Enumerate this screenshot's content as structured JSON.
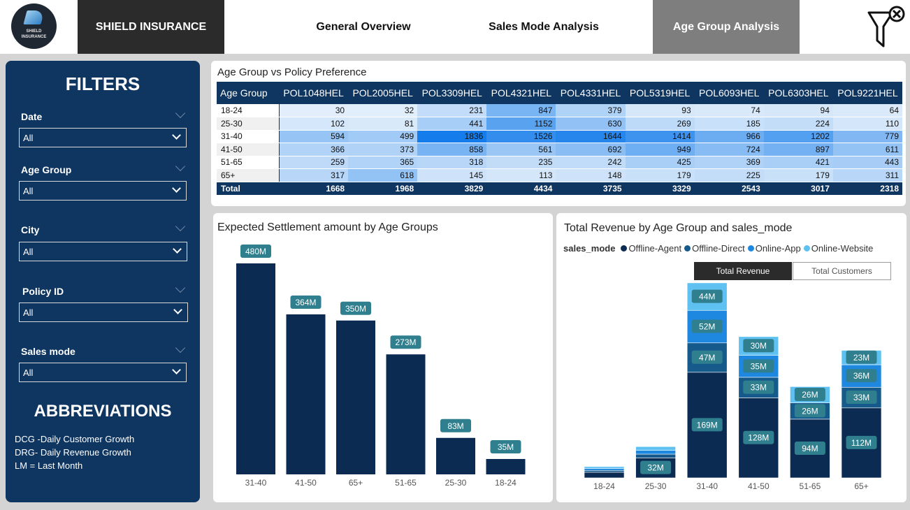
{
  "header": {
    "logo_text_line1": "SHIELD",
    "logo_text_line2": "INSURANCE",
    "brand": "SHIELD INSURANCE",
    "tabs": [
      {
        "label": "General Overview"
      },
      {
        "label": "Sales Mode Analysis"
      },
      {
        "label": "Age Group Analysis"
      }
    ],
    "clear_filter_icon": "filter-clear-icon"
  },
  "sidebar": {
    "title": "FILTERS",
    "filters": [
      {
        "label": "Date",
        "value": "All"
      },
      {
        "label": "Age Group",
        "value": "All"
      },
      {
        "label": "City",
        "value": "All"
      },
      {
        "label": "Policy ID",
        "value": "All"
      },
      {
        "label": "Sales mode",
        "value": "All"
      }
    ],
    "abbr_title": "ABBREVIATIONS",
    "abbreviations": [
      "DCG -Daily Customer Growth",
      "DRG- Daily Revenue Growth",
      "LM = Last Month"
    ]
  },
  "matrix": {
    "title": "Age Group vs Policy Preference",
    "row_header": "Age Group",
    "columns": [
      "POL1048HEL",
      "POL2005HEL",
      "POL3309HEL",
      "POL4321HEL",
      "POL4331HEL",
      "POL5319HEL",
      "POL6093HEL",
      "POL6303HEL",
      "POL9221HEL"
    ],
    "rows": [
      {
        "label": "18-24",
        "values": [
          30,
          32,
          231,
          847,
          379,
          93,
          74,
          94,
          64
        ]
      },
      {
        "label": "25-30",
        "values": [
          102,
          81,
          441,
          1152,
          630,
          269,
          185,
          224,
          110
        ]
      },
      {
        "label": "31-40",
        "values": [
          594,
          499,
          1836,
          1526,
          1644,
          1414,
          966,
          1202,
          779
        ]
      },
      {
        "label": "41-50",
        "values": [
          366,
          373,
          858,
          561,
          692,
          949,
          724,
          897,
          611
        ]
      },
      {
        "label": "51-65",
        "values": [
          259,
          365,
          318,
          235,
          242,
          425,
          369,
          421,
          443
        ]
      },
      {
        "label": "65+",
        "values": [
          317,
          618,
          145,
          113,
          148,
          179,
          225,
          179,
          311
        ]
      }
    ],
    "total": {
      "label": "Total",
      "values": [
        1668,
        1968,
        3829,
        4434,
        3735,
        3329,
        2543,
        3017,
        2318
      ]
    }
  },
  "settlement": {
    "title": "Expected Settlement amount by Age Groups"
  },
  "revenue": {
    "title": "Total Revenue by Age Group and sales_mode",
    "legend_title": "sales_mode",
    "toggle_active": "Total Revenue",
    "toggle_inactive": "Total Customers"
  },
  "chart_data": [
    {
      "type": "bar",
      "title": "Expected Settlement amount by Age Groups",
      "categories": [
        "31-40",
        "41-50",
        "65+",
        "51-65",
        "25-30",
        "18-24"
      ],
      "values": [
        480,
        364,
        350,
        273,
        83,
        35
      ],
      "labels": [
        "480M",
        "364M",
        "350M",
        "273M",
        "83M",
        "35M"
      ],
      "unit": "M",
      "color": "#0b2b53",
      "label_color": "#2f7f8f"
    },
    {
      "type": "bar",
      "stacked": true,
      "title": "Total Revenue by Age Group and sales_mode",
      "categories": [
        "18-24",
        "25-30",
        "31-40",
        "41-50",
        "51-65",
        "65+"
      ],
      "series": [
        {
          "name": "Offline-Agent",
          "color": "#0b2b53",
          "values": [
            9,
            32,
            169,
            128,
            94,
            112
          ]
        },
        {
          "name": "Offline-Direct",
          "color": "#165a8c",
          "values": [
            3,
            6,
            47,
            33,
            26,
            33
          ]
        },
        {
          "name": "Online-App",
          "color": "#1e88e0",
          "values": [
            3,
            6,
            52,
            35,
            0,
            36
          ]
        },
        {
          "name": "Online-Website",
          "color": "#5ec1f2",
          "values": [
            3,
            6,
            44,
            30,
            26,
            23
          ]
        }
      ],
      "labels": [
        [
          null,
          null,
          null,
          null
        ],
        [
          "32M",
          null,
          null,
          null
        ],
        [
          "169M",
          "47M",
          "52M",
          "44M"
        ],
        [
          "128M",
          "33M",
          "35M",
          "30M"
        ],
        [
          "94M",
          "26M",
          null,
          "26M"
        ],
        [
          "112M",
          "33M",
          "36M",
          "23M"
        ]
      ],
      "unit": "M"
    }
  ]
}
